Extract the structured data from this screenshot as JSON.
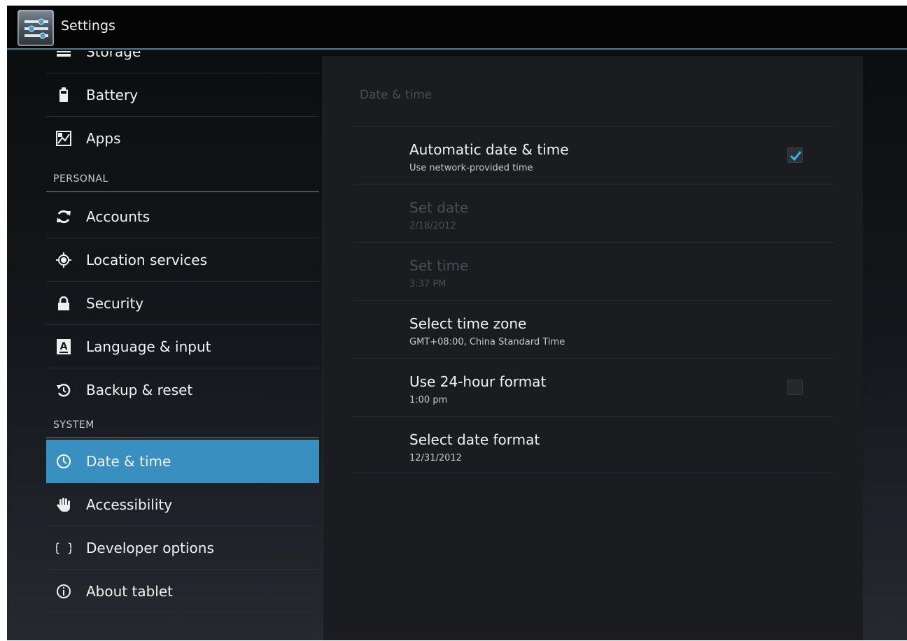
{
  "app": {
    "title": "Settings",
    "icon": "settings-sliders-icon"
  },
  "sidebar": {
    "items": [
      {
        "label": "Storage",
        "icon": "storage-icon"
      },
      {
        "label": "Battery",
        "icon": "battery-icon"
      },
      {
        "label": "Apps",
        "icon": "apps-icon"
      },
      {
        "label": "Accounts",
        "icon": "sync-icon"
      },
      {
        "label": "Location services",
        "icon": "location-icon"
      },
      {
        "label": "Security",
        "icon": "lock-icon"
      },
      {
        "label": "Language & input",
        "icon": "keyboard-a-icon"
      },
      {
        "label": "Backup & reset",
        "icon": "restore-icon"
      },
      {
        "label": "Date & time",
        "icon": "clock-icon",
        "selected": true
      },
      {
        "label": "Accessibility",
        "icon": "hand-icon"
      },
      {
        "label": "Developer options",
        "icon": "braces-icon"
      },
      {
        "label": "About tablet",
        "icon": "info-icon"
      }
    ],
    "headers": {
      "personal": "PERSONAL",
      "system": "SYSTEM"
    },
    "selected_color": "#3a8fc1"
  },
  "detail": {
    "title": "Date & time",
    "prefs": [
      {
        "title": "Automatic date & time",
        "summary": "Use network-provided time",
        "checkbox": "checked",
        "enabled": true
      },
      {
        "title": "Set date",
        "summary": "2/18/2012",
        "enabled": false
      },
      {
        "title": "Set time",
        "summary": "3:37 PM",
        "enabled": false
      },
      {
        "title": "Select time zone",
        "summary": "GMT+08:00, China Standard Time",
        "enabled": true
      },
      {
        "title": "Use 24-hour format",
        "summary": "1:00 pm",
        "checkbox": "unchecked",
        "enabled": true
      },
      {
        "title": "Select date format",
        "summary": "12/31/2012",
        "enabled": true
      }
    ]
  },
  "colors": {
    "accent": "#3a8fc1",
    "actionbar_divider": "#3d7f95",
    "check": "#33b5e5"
  }
}
